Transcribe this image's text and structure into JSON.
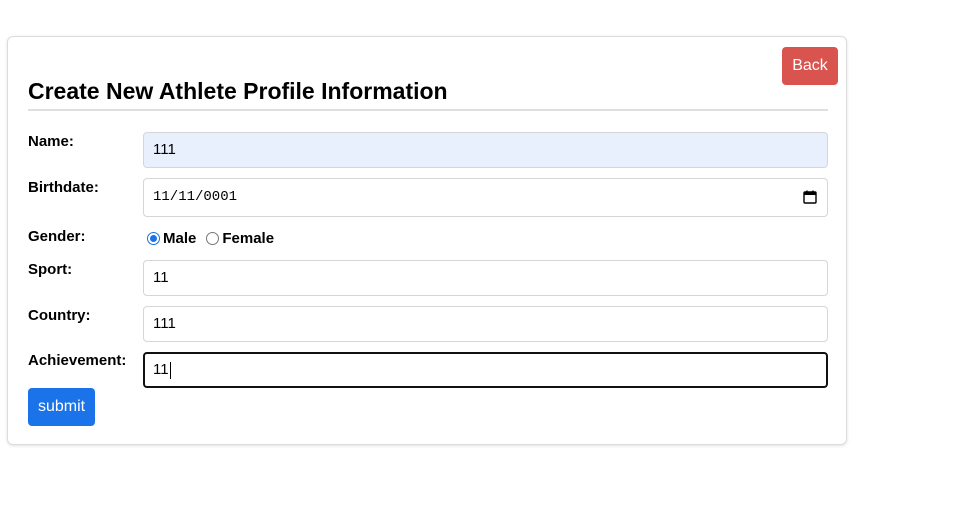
{
  "header": {
    "back_label": "Back",
    "title": "Create New Athlete Profile Information"
  },
  "form": {
    "name": {
      "label": "Name:",
      "value": "111"
    },
    "birthdate": {
      "label": "Birthdate:",
      "value": "11/11/0001"
    },
    "gender": {
      "label": "Gender:",
      "options": [
        "Male",
        "Female"
      ],
      "selected": "Male"
    },
    "sport": {
      "label": "Sport:",
      "value": "11"
    },
    "country": {
      "label": "Country:",
      "value": "111"
    },
    "achievement": {
      "label": "Achievement:",
      "value": "11"
    },
    "submit_label": "submit"
  },
  "icons": {
    "date_picker": "calendar-icon"
  },
  "colors": {
    "back_button": "#d9534f",
    "submit_button": "#1a73e8",
    "autofill_background": "#e8f0fe",
    "radio_accent": "#1a73e8"
  }
}
